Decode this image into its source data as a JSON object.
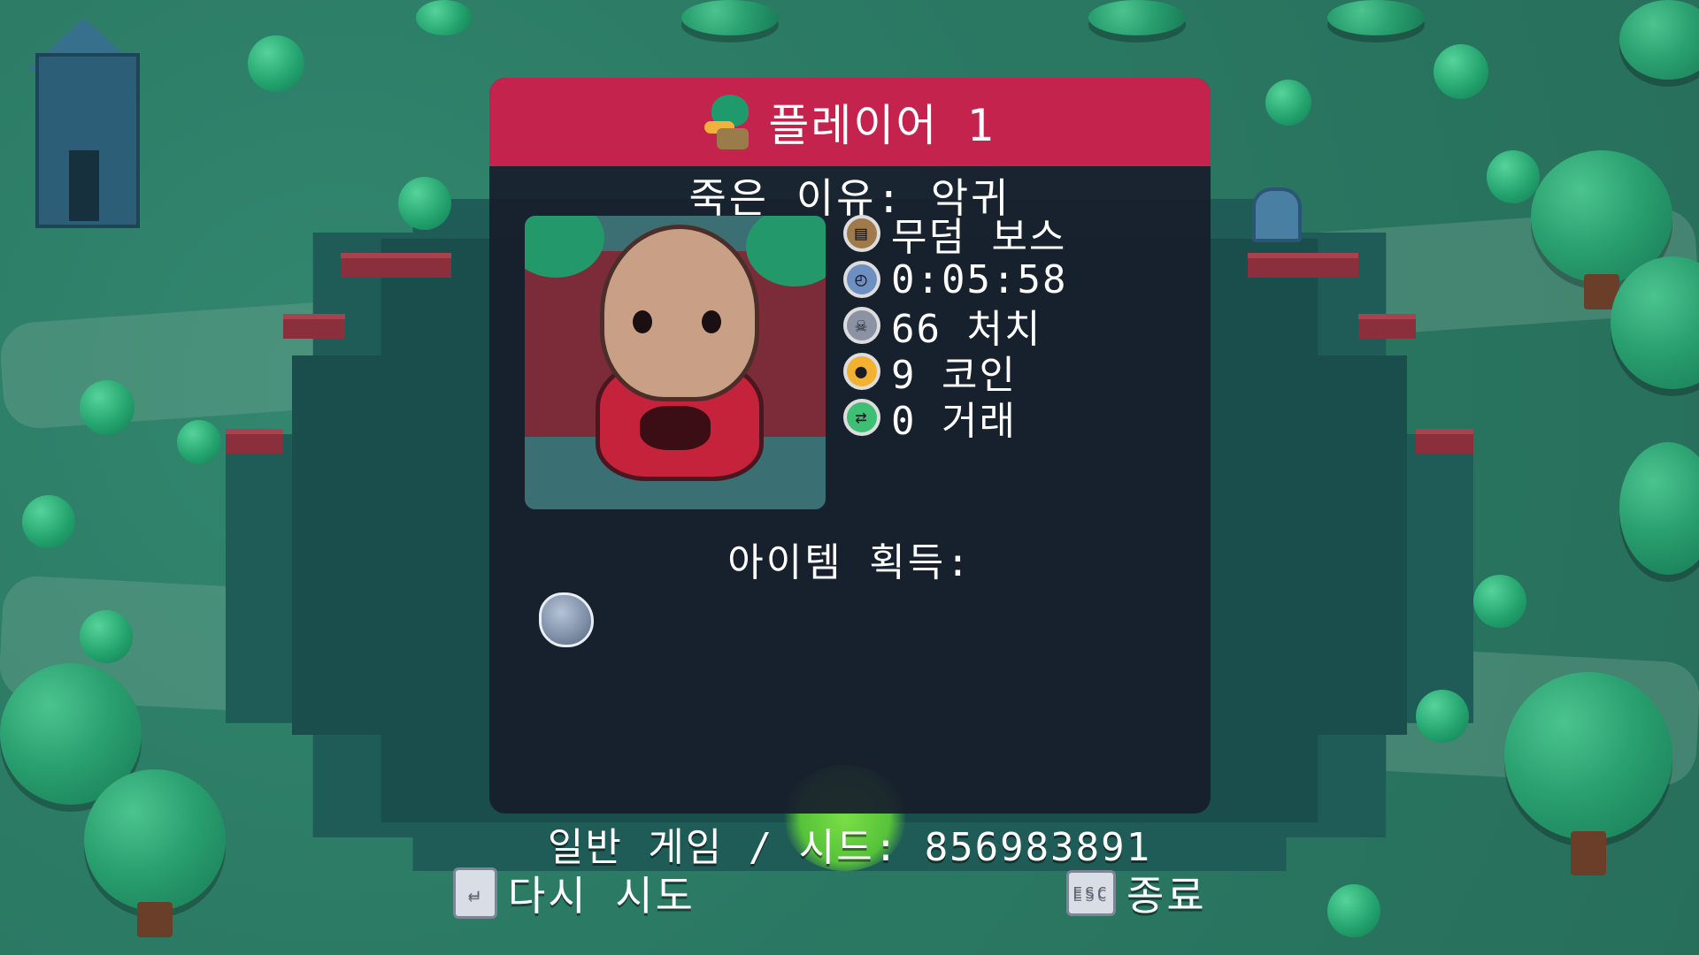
{
  "header": {
    "title": "플레이어 1",
    "icon": "duck-player-icon",
    "color": "#c4234d"
  },
  "death": {
    "cause": "죽은 이유: 악귀"
  },
  "portrait": {
    "icon": "potato-boss-portrait"
  },
  "stats": [
    {
      "icon": "map-icon",
      "text": "무덤 보스",
      "icon_color": "#a07a4c"
    },
    {
      "icon": "clock-icon",
      "text": "0:05:58",
      "icon_color": "#6e8fc2"
    },
    {
      "icon": "skull-icon",
      "text": "66 처치",
      "icon_color": "#8a92a3"
    },
    {
      "icon": "coin-icon",
      "text": "9 코인",
      "icon_color": "#f2b130"
    },
    {
      "icon": "trade-arrows-icon",
      "text": "0 거래",
      "icon_color": "#3fbf74"
    }
  ],
  "items": {
    "label": "아이템 획득:",
    "list": [
      {
        "icon": "gray-stone-item-icon"
      }
    ]
  },
  "footer": {
    "seed_text": "일반 게임 / 시드: 856983891",
    "retry": {
      "label": "다시 시도",
      "icon": "enter-key-icon",
      "key": "↵"
    },
    "quit": {
      "label": "종료",
      "icon": "esc-key-icon",
      "key": "ESC"
    }
  }
}
